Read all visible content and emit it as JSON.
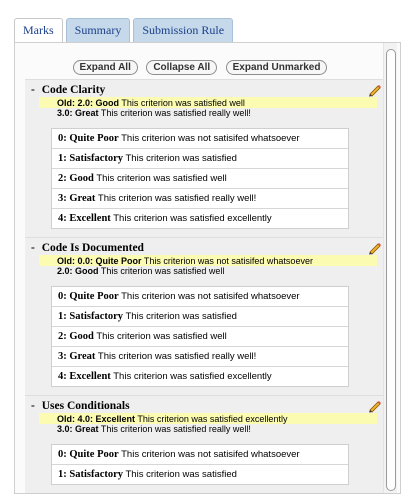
{
  "tabs": [
    {
      "label": "Marks",
      "active": true
    },
    {
      "label": "Summary",
      "active": false
    },
    {
      "label": "Submission Rule",
      "active": false
    }
  ],
  "controls": {
    "expand_all": "Expand All",
    "collapse_all": "Collapse All",
    "expand_unmarked": "Expand Unmarked"
  },
  "criteria": [
    {
      "title": "Code Clarity",
      "collapse_symbol": "-",
      "old": {
        "prefix": "Old:",
        "score": "2.0: Good",
        "desc": "This criterion was satisfied well"
      },
      "current": {
        "score": "3.0: Great",
        "desc": "This criterion was satisfied really well!"
      },
      "levels": [
        {
          "name": "0: Quite Poor",
          "desc": "This criterion was not satisifed whatsoever"
        },
        {
          "name": "1: Satisfactory",
          "desc": "This criterion was satisfied"
        },
        {
          "name": "2: Good",
          "desc": "This criterion was satisfied well"
        },
        {
          "name": "3: Great",
          "desc": "This criterion was satisfied really well!"
        },
        {
          "name": "4: Excellent",
          "desc": "This criterion was satisfied excellently"
        }
      ]
    },
    {
      "title": "Code Is Documented",
      "collapse_symbol": "-",
      "old": {
        "prefix": "Old:",
        "score": "0.0: Quite Poor",
        "desc": "This criterion was not satisifed whatsoever"
      },
      "current": {
        "score": "2.0: Good",
        "desc": "This criterion was satisfied well"
      },
      "levels": [
        {
          "name": "0: Quite Poor",
          "desc": "This criterion was not satisifed whatsoever"
        },
        {
          "name": "1: Satisfactory",
          "desc": "This criterion was satisfied"
        },
        {
          "name": "2: Good",
          "desc": "This criterion was satisfied well"
        },
        {
          "name": "3: Great",
          "desc": "This criterion was satisfied really well!"
        },
        {
          "name": "4: Excellent",
          "desc": "This criterion was satisfied excellently"
        }
      ]
    },
    {
      "title": "Uses Conditionals",
      "collapse_symbol": "-",
      "old": {
        "prefix": "Old:",
        "score": "4.0: Excellent",
        "desc": "This criterion was satisfied excellently"
      },
      "current": {
        "score": "3.0: Great",
        "desc": "This criterion was satisfied really well!"
      },
      "levels": [
        {
          "name": "0: Quite Poor",
          "desc": "This criterion was not satisifed whatsoever"
        },
        {
          "name": "1: Satisfactory",
          "desc": "This criterion was satisfied"
        }
      ]
    }
  ],
  "icons": {
    "edit": "pencil-edit-icon"
  },
  "colors": {
    "tab_bg": "#c6d9ea",
    "tab_text": "#1b3f8a",
    "old_highlight": "#fbfbb1",
    "section_bg": "#efefef"
  }
}
